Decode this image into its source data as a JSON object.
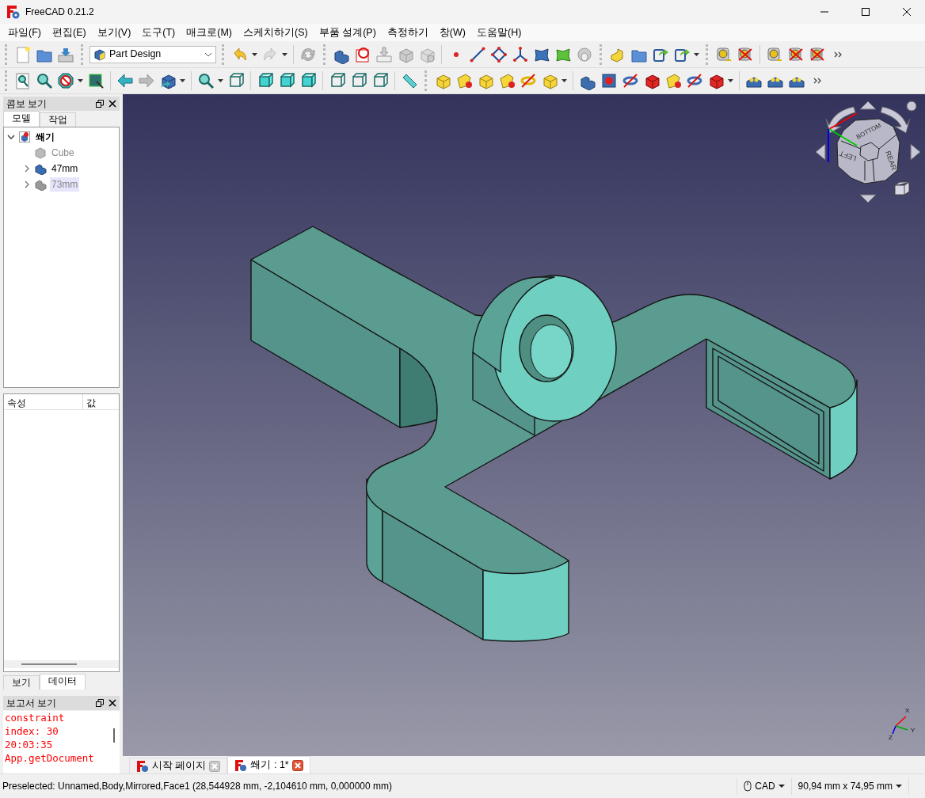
{
  "window": {
    "title": "FreeCAD 0.21.2"
  },
  "menu": [
    "파일(F)",
    "편집(E)",
    "보기(V)",
    "도구(T)",
    "매크로(M)",
    "스케치하기(S)",
    "부품 설계(P)",
    "측정하기",
    "창(W)",
    "도움말(H)"
  ],
  "workbench": {
    "value": "Part Design"
  },
  "combo_view": {
    "title": "콤보 보기",
    "tabs": [
      {
        "label": "모델",
        "selected": true
      },
      {
        "label": "작업",
        "selected": false
      }
    ],
    "tree": [
      {
        "label": "쐐기",
        "kind": "document",
        "expanded": true,
        "visible": true,
        "selected": false,
        "children": [
          {
            "label": "Cube",
            "kind": "box",
            "expanded": false,
            "visible": false,
            "selected": false
          },
          {
            "label": "47mm",
            "kind": "body",
            "expanded": false,
            "visible": true,
            "selected": false
          },
          {
            "label": "73mm",
            "kind": "body",
            "expanded": false,
            "visible": false,
            "selected": true
          }
        ]
      }
    ],
    "property_columns": [
      "속성",
      "값"
    ],
    "bottom_tabs": [
      {
        "label": "보기",
        "selected": false
      },
      {
        "label": "데이터",
        "selected": true
      }
    ]
  },
  "report_view": {
    "title": "보고서 보기",
    "lines": [
      "constraint",
      "index: 30",
      "20:03:35",
      "App.getDocument"
    ]
  },
  "document_tabs": [
    {
      "label": "시작 페이지",
      "selected": false
    },
    {
      "label": "쐐기 : 1*",
      "selected": true
    }
  ],
  "nav_cube": {
    "faces": [
      "BOTTOM",
      "LEFT",
      "REAR"
    ]
  },
  "axis_labels": [
    "X",
    "Y",
    "Z"
  ],
  "status_bar": {
    "message": "Preselected: Unnamed,Body,Mirrored,Face1 (28,544928 mm, -2,104610 mm, 0,000000 mm)",
    "navigation_style": "CAD",
    "dimensions": "90,94 mm x 74,95 mm"
  }
}
